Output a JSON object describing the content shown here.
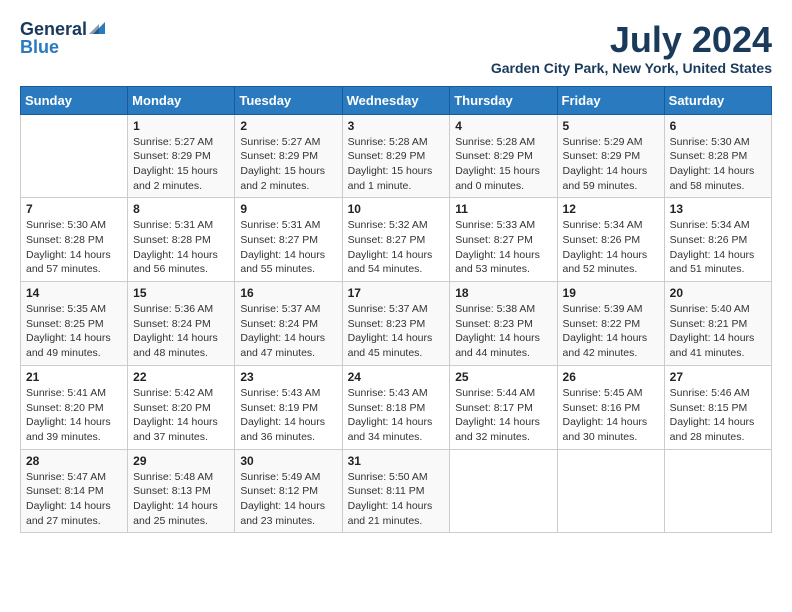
{
  "header": {
    "logo_general": "General",
    "logo_blue": "Blue",
    "month_title": "July 2024",
    "location": "Garden City Park, New York, United States"
  },
  "days_of_week": [
    "Sunday",
    "Monday",
    "Tuesday",
    "Wednesday",
    "Thursday",
    "Friday",
    "Saturday"
  ],
  "weeks": [
    [
      {
        "day": "",
        "info": ""
      },
      {
        "day": "1",
        "info": "Sunrise: 5:27 AM\nSunset: 8:29 PM\nDaylight: 15 hours\nand 2 minutes."
      },
      {
        "day": "2",
        "info": "Sunrise: 5:27 AM\nSunset: 8:29 PM\nDaylight: 15 hours\nand 2 minutes."
      },
      {
        "day": "3",
        "info": "Sunrise: 5:28 AM\nSunset: 8:29 PM\nDaylight: 15 hours\nand 1 minute."
      },
      {
        "day": "4",
        "info": "Sunrise: 5:28 AM\nSunset: 8:29 PM\nDaylight: 15 hours\nand 0 minutes."
      },
      {
        "day": "5",
        "info": "Sunrise: 5:29 AM\nSunset: 8:29 PM\nDaylight: 14 hours\nand 59 minutes."
      },
      {
        "day": "6",
        "info": "Sunrise: 5:30 AM\nSunset: 8:28 PM\nDaylight: 14 hours\nand 58 minutes."
      }
    ],
    [
      {
        "day": "7",
        "info": "Sunrise: 5:30 AM\nSunset: 8:28 PM\nDaylight: 14 hours\nand 57 minutes."
      },
      {
        "day": "8",
        "info": "Sunrise: 5:31 AM\nSunset: 8:28 PM\nDaylight: 14 hours\nand 56 minutes."
      },
      {
        "day": "9",
        "info": "Sunrise: 5:31 AM\nSunset: 8:27 PM\nDaylight: 14 hours\nand 55 minutes."
      },
      {
        "day": "10",
        "info": "Sunrise: 5:32 AM\nSunset: 8:27 PM\nDaylight: 14 hours\nand 54 minutes."
      },
      {
        "day": "11",
        "info": "Sunrise: 5:33 AM\nSunset: 8:27 PM\nDaylight: 14 hours\nand 53 minutes."
      },
      {
        "day": "12",
        "info": "Sunrise: 5:34 AM\nSunset: 8:26 PM\nDaylight: 14 hours\nand 52 minutes."
      },
      {
        "day": "13",
        "info": "Sunrise: 5:34 AM\nSunset: 8:26 PM\nDaylight: 14 hours\nand 51 minutes."
      }
    ],
    [
      {
        "day": "14",
        "info": "Sunrise: 5:35 AM\nSunset: 8:25 PM\nDaylight: 14 hours\nand 49 minutes."
      },
      {
        "day": "15",
        "info": "Sunrise: 5:36 AM\nSunset: 8:24 PM\nDaylight: 14 hours\nand 48 minutes."
      },
      {
        "day": "16",
        "info": "Sunrise: 5:37 AM\nSunset: 8:24 PM\nDaylight: 14 hours\nand 47 minutes."
      },
      {
        "day": "17",
        "info": "Sunrise: 5:37 AM\nSunset: 8:23 PM\nDaylight: 14 hours\nand 45 minutes."
      },
      {
        "day": "18",
        "info": "Sunrise: 5:38 AM\nSunset: 8:23 PM\nDaylight: 14 hours\nand 44 minutes."
      },
      {
        "day": "19",
        "info": "Sunrise: 5:39 AM\nSunset: 8:22 PM\nDaylight: 14 hours\nand 42 minutes."
      },
      {
        "day": "20",
        "info": "Sunrise: 5:40 AM\nSunset: 8:21 PM\nDaylight: 14 hours\nand 41 minutes."
      }
    ],
    [
      {
        "day": "21",
        "info": "Sunrise: 5:41 AM\nSunset: 8:20 PM\nDaylight: 14 hours\nand 39 minutes."
      },
      {
        "day": "22",
        "info": "Sunrise: 5:42 AM\nSunset: 8:20 PM\nDaylight: 14 hours\nand 37 minutes."
      },
      {
        "day": "23",
        "info": "Sunrise: 5:43 AM\nSunset: 8:19 PM\nDaylight: 14 hours\nand 36 minutes."
      },
      {
        "day": "24",
        "info": "Sunrise: 5:43 AM\nSunset: 8:18 PM\nDaylight: 14 hours\nand 34 minutes."
      },
      {
        "day": "25",
        "info": "Sunrise: 5:44 AM\nSunset: 8:17 PM\nDaylight: 14 hours\nand 32 minutes."
      },
      {
        "day": "26",
        "info": "Sunrise: 5:45 AM\nSunset: 8:16 PM\nDaylight: 14 hours\nand 30 minutes."
      },
      {
        "day": "27",
        "info": "Sunrise: 5:46 AM\nSunset: 8:15 PM\nDaylight: 14 hours\nand 28 minutes."
      }
    ],
    [
      {
        "day": "28",
        "info": "Sunrise: 5:47 AM\nSunset: 8:14 PM\nDaylight: 14 hours\nand 27 minutes."
      },
      {
        "day": "29",
        "info": "Sunrise: 5:48 AM\nSunset: 8:13 PM\nDaylight: 14 hours\nand 25 minutes."
      },
      {
        "day": "30",
        "info": "Sunrise: 5:49 AM\nSunset: 8:12 PM\nDaylight: 14 hours\nand 23 minutes."
      },
      {
        "day": "31",
        "info": "Sunrise: 5:50 AM\nSunset: 8:11 PM\nDaylight: 14 hours\nand 21 minutes."
      },
      {
        "day": "",
        "info": ""
      },
      {
        "day": "",
        "info": ""
      },
      {
        "day": "",
        "info": ""
      }
    ]
  ]
}
